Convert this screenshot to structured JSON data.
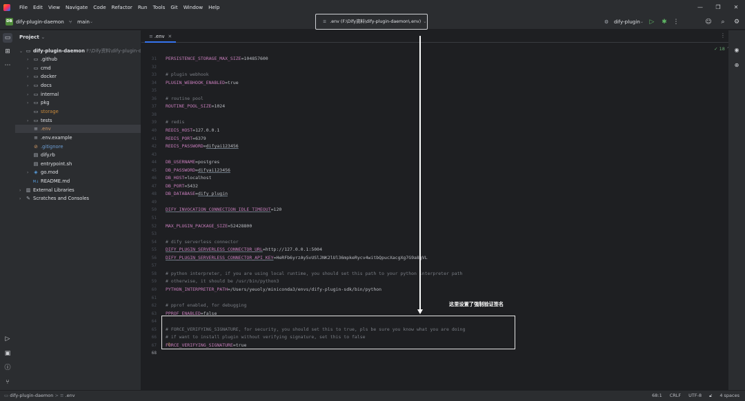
{
  "menu": [
    "File",
    "Edit",
    "View",
    "Navigate",
    "Code",
    "Refactor",
    "Run",
    "Tools",
    "Git",
    "Window",
    "Help"
  ],
  "window_controls": {
    "minimize": "—",
    "restore": "❐",
    "close": "✕"
  },
  "toolbar": {
    "project_badge": "DB",
    "project_name": "dify-plugin-daemon",
    "branch": "main",
    "search_text": ".env (F:\\Dify资料\\dify-plugin-daemon\\.env)",
    "run_config": "dify-plugin"
  },
  "project_panel": {
    "title": "Project",
    "root_name": "dify-plugin-daemon",
    "root_path": "F:\\Dify资料\\dify-plugin-daem",
    "items": [
      {
        "label": ".github",
        "icon": "folder-icon"
      },
      {
        "label": "cmd",
        "icon": "folder-icon"
      },
      {
        "label": "docker",
        "icon": "folder-icon"
      },
      {
        "label": "docs",
        "icon": "folder-icon"
      },
      {
        "label": "internal",
        "icon": "folder-icon"
      },
      {
        "label": "pkg",
        "icon": "folder-icon"
      },
      {
        "label": "storage",
        "icon": "folder-icon"
      },
      {
        "label": "tests",
        "icon": "folder-icon"
      },
      {
        "label": ".env",
        "icon": "env-file-icon"
      },
      {
        "label": ".env.example",
        "icon": "env-file-icon"
      },
      {
        "label": ".gitignore",
        "icon": "gitignore-icon"
      },
      {
        "label": "dify.rb",
        "icon": "file-icon"
      },
      {
        "label": "entrypoint.sh",
        "icon": "file-icon"
      },
      {
        "label": "go.mod",
        "icon": "go-mod-icon"
      },
      {
        "label": "README.md",
        "icon": "markdown-icon"
      },
      {
        "label": "External Libraries",
        "icon": "library-icon"
      },
      {
        "label": "Scratches and Consoles",
        "icon": "scratch-icon"
      }
    ]
  },
  "editor": {
    "tab_name": ".env",
    "inspection_count": "18",
    "lines": [
      {
        "n": "31",
        "key": "PERSISTENCE_STORAGE_MAX_SIZE",
        "eq": "=",
        "val": "104857600"
      },
      {
        "n": "32",
        "text": ""
      },
      {
        "n": "33",
        "comment": "# plugin webhook"
      },
      {
        "n": "34",
        "key": "PLUGIN_WEBHOOK_ENABLED",
        "eq": "=",
        "val": "true"
      },
      {
        "n": "35",
        "text": ""
      },
      {
        "n": "36",
        "comment": "# routine pool"
      },
      {
        "n": "37",
        "key": "ROUTINE_POOL_SIZE",
        "eq": "=",
        "val": "1024"
      },
      {
        "n": "38",
        "text": ""
      },
      {
        "n": "39",
        "comment": "# redis"
      },
      {
        "n": "40",
        "key": "REDIS_HOST",
        "eq": "=",
        "val": "127.0.0.1"
      },
      {
        "n": "41",
        "key": "REDIS_PORT",
        "eq": "=",
        "val": "6379"
      },
      {
        "n": "42",
        "key": "REDIS_PASSWORD",
        "eq": "=",
        "val": "difyai123456"
      },
      {
        "n": "43",
        "text": ""
      },
      {
        "n": "44",
        "key": "DB_USERNAME",
        "eq": "=",
        "val": "postgres"
      },
      {
        "n": "45",
        "key": "DB_PASSWORD",
        "eq": "=",
        "val": "difyai123456"
      },
      {
        "n": "46",
        "key": "DB_HOST",
        "eq": "=",
        "val": "localhost"
      },
      {
        "n": "47",
        "key": "DB_PORT",
        "eq": "=",
        "val": "5432"
      },
      {
        "n": "48",
        "key": "DB_DATABASE",
        "eq": "=",
        "val": "dify_plugin"
      },
      {
        "n": "49",
        "text": ""
      },
      {
        "n": "50",
        "key": "DIFY_INVOCATION_CONNECTION_IDLE_TIMEOUT",
        "eq": "=",
        "val": "120"
      },
      {
        "n": "51",
        "text": ""
      },
      {
        "n": "52",
        "key": "MAX_PLUGIN_PACKAGE_SIZE",
        "eq": "=",
        "val": "52428800"
      },
      {
        "n": "53",
        "text": ""
      },
      {
        "n": "54",
        "comment": "# dify serverless connector"
      },
      {
        "n": "55",
        "key": "DIFY_PLUGIN_SERVERLESS_CONNECTOR_URL",
        "eq": "=",
        "val": "http://127.0.0.1:5004"
      },
      {
        "n": "56",
        "key": "DIFY_PLUGIN_SERVERLESS_CONNECTOR_API_KEY",
        "eq": "=",
        "val": "HeRFb6yrzAy5vUSlJNK2lUl36mpkeRycv4witbQpucXacgXg7G9a8gVL"
      },
      {
        "n": "57",
        "text": ""
      },
      {
        "n": "58",
        "comment": "# python interpreter, if you are using local runtime, you should set this path to your python interpreter path"
      },
      {
        "n": "59",
        "comment": "# otherwise, it should be /usr/bin/python3"
      },
      {
        "n": "60",
        "key": "PYTHON_INTERPRETER_PATH",
        "eq": "=",
        "val": "/Users/yeuoly/miniconda3/envs/dify-plugin-sdk/bin/python"
      },
      {
        "n": "61",
        "text": ""
      },
      {
        "n": "62",
        "comment": "# pprof enabled, for debugging"
      },
      {
        "n": "63",
        "key": "PPROF_ENABLED",
        "eq": "=",
        "val": "false"
      },
      {
        "n": "64",
        "text": ""
      },
      {
        "n": "65",
        "comment": "# FORCE_VERIFYING_SIGNATURE, for security, you should set this to true, pls be sure you know what you are doing"
      },
      {
        "n": "66",
        "comment": "# if want to install plugin without verifying signature, set this to false"
      },
      {
        "n": "67",
        "key": "FORCE_VERIFYING_SIGNATURE",
        "eq": "=",
        "val": "true"
      },
      {
        "n": "68",
        "text": ""
      }
    ]
  },
  "annotation": {
    "text": "这里设置了强制验证签名"
  },
  "statusbar": {
    "breadcrumb_project": "dify-plugin-daemon",
    "breadcrumb_sep": ">",
    "breadcrumb_file": ".env",
    "position": "68:1",
    "line_sep": "CRLF",
    "encoding": "UTF-8",
    "indent": "4 spaces"
  }
}
